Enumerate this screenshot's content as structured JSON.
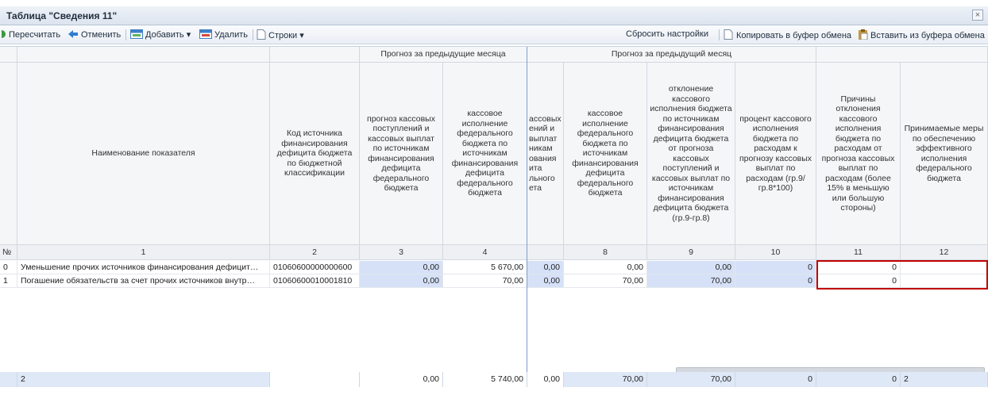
{
  "window": {
    "title": "Таблица \"Сведения 11\"",
    "close_glyph": "×"
  },
  "toolbar": {
    "recalc": "Пересчитать",
    "undo": "Отменить",
    "add": "Добавить",
    "delete": "Удалить",
    "rows": "Строки",
    "reset": "Сбросить настройки",
    "copy": "Копировать в буфер обмена",
    "paste": "Вставить из буфера обмена"
  },
  "groups": {
    "prev_months": "Прогноз за предыдущие месяца",
    "prev_month": "Прогноз за предыдущий месяц"
  },
  "columns": {
    "name": "Наименование показателя",
    "code": "Код источника финансирования дефицита бюджета по бюджетной классификации",
    "c3": "прогноз кассовых поступлений и кассовых выплат по источникам финансирования дефицита федерального бюджета",
    "c4": "кассовое исполнение федерального бюджета по источникам финансирования дефицита федерального бюджета",
    "c7": "ассовых ений и выплат никам ования ита льного ета",
    "c8": "кассовое исполнение федерального бюджета по источникам финансирования дефицита федерального бюджета",
    "c9": "отклонение кассового исполнения бюджета по источникам финансирования дефицита бюджета от прогноза кассовых поступлений и кассовых выплат по источникам финансирования дефицита бюджета (гр.9-гр.8)",
    "c10": "процент кассового исполнения бюджета по расходам к прогнозу кассовых выплат по расходам (гр.9/ гр.8*100)",
    "c11": "Причины отклонения кассового исполнения бюджета по расходам от прогноза кассовых выплат по расходам (более 15% в меньшую или большую стороны)",
    "c12": "Принимаемые меры по обеспечению эффективного исполнения федерального бюджета"
  },
  "col_numbers": {
    "n0": "№",
    "n1": "1",
    "n2": "2",
    "n3": "3",
    "n4": "4",
    "n8": "8",
    "n9": "9",
    "n10": "10",
    "n11": "11",
    "n12": "12"
  },
  "rows": [
    {
      "num": "0",
      "name": "Уменьшение прочих источников финансирования дефицит…",
      "code": "01060600000000600",
      "c3": "0,00",
      "c4": "5 670,00",
      "c7": "0,00",
      "c8": "0,00",
      "c9": "0,00",
      "c10": "0",
      "c11": "0",
      "c12": ""
    },
    {
      "num": "1",
      "name": "Погашение обязательств за счет прочих источников внутр…",
      "code": "01060600010001810",
      "c3": "0,00",
      "c4": "70,00",
      "c7": "0,00",
      "c8": "70,00",
      "c9": "70,00",
      "c10": "0",
      "c11": "0",
      "c12": ""
    }
  ],
  "footer": {
    "name": "2",
    "code": "",
    "c3": "0,00",
    "c4": "5 740,00",
    "c7": "0,00",
    "c8": "70,00",
    "c9": "70,00",
    "c10": "0",
    "c11": "0",
    "c12": "2"
  },
  "colors": {
    "accent": "#d6e1f7",
    "highlight": "#c00000"
  }
}
